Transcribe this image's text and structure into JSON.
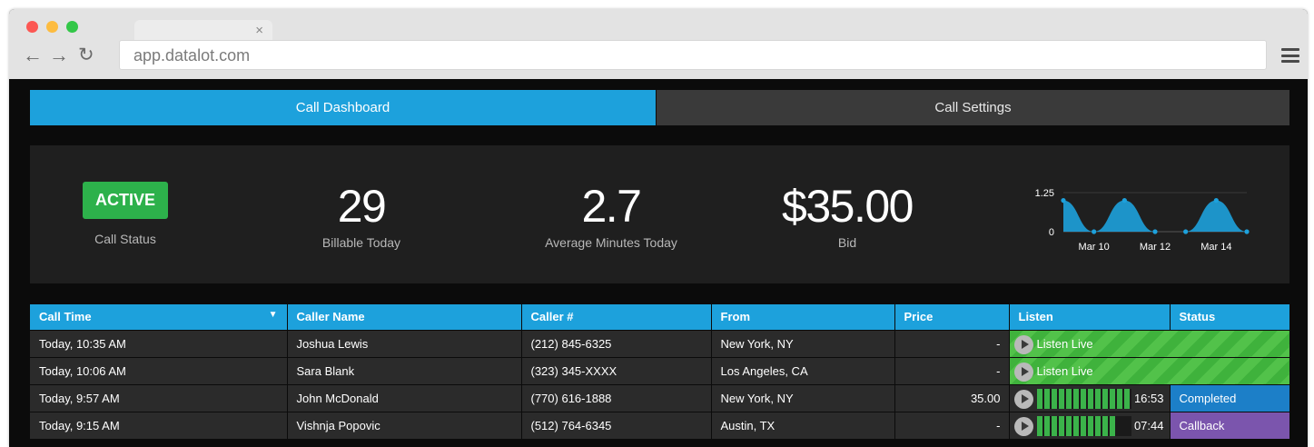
{
  "browser": {
    "url": "app.datalot.com",
    "tab_close": "×",
    "back_icon": "arrow-left-icon",
    "forward_icon": "arrow-right-icon",
    "reload_icon": "reload-icon",
    "menu_icon": "hamburger-menu-icon"
  },
  "tabs": [
    {
      "label": "Call Dashboard",
      "active": true
    },
    {
      "label": "Call Settings",
      "active": false
    }
  ],
  "stats": {
    "status_badge": "ACTIVE",
    "status_label": "Call Status",
    "billable_value": "29",
    "billable_label": "Billable Today",
    "avg_minutes_value": "2.7",
    "avg_minutes_label": "Average Minutes Today",
    "bid_value": "$35.00",
    "bid_label": "Bid"
  },
  "chart_data": {
    "type": "area",
    "title": "",
    "xlabel": "",
    "ylabel": "",
    "y_ticks": [
      "1.25",
      "0"
    ],
    "x_ticks": [
      "Mar 10",
      "Mar 12",
      "Mar 14"
    ],
    "ylim": [
      0,
      1.25
    ],
    "x": [
      "Mar 9",
      "Mar 10",
      "Mar 11",
      "Mar 12",
      "Mar 13",
      "Mar 14",
      "Mar 15"
    ],
    "values": [
      1,
      0,
      1,
      0,
      0,
      1,
      0
    ],
    "grid": false,
    "legend": "none"
  },
  "table": {
    "columns": [
      "Call Time",
      "Caller Name",
      "Caller #",
      "From",
      "Price",
      "Listen",
      "Status"
    ],
    "sort_indicator": "▼",
    "rows": [
      {
        "time": "Today, 10:35 AM",
        "name": "Joshua Lewis",
        "number": "(212) 845-6325",
        "from": "New York, NY",
        "price": "-",
        "listen": "Listen Live",
        "duration": "",
        "level": null,
        "status": ""
      },
      {
        "time": "Today, 10:06 AM",
        "name": "Sara Blank",
        "number": "(323) 345-XXXX",
        "from": "Los Angeles, CA",
        "price": "-",
        "listen": "Listen Live",
        "duration": "",
        "level": null,
        "status": ""
      },
      {
        "time": "Today, 9:57 AM",
        "name": "John McDonald",
        "number": "(770) 616-1888",
        "from": "New York, NY",
        "price": "35.00",
        "listen": "",
        "duration": "16:53",
        "level": 1.0,
        "status": "Completed"
      },
      {
        "time": "Today, 9:15 AM",
        "name": "Vishnja Popovic",
        "number": "(512) 764-6345",
        "from": "Austin, TX",
        "price": "-",
        "listen": "",
        "duration": "07:44",
        "level": 0.85,
        "status": "Callback"
      }
    ]
  },
  "colors": {
    "accent_blue": "#1da1dc",
    "active_green": "#2db14b",
    "completed_blue": "#1c7fc8",
    "callback_purple": "#7b55ad"
  }
}
